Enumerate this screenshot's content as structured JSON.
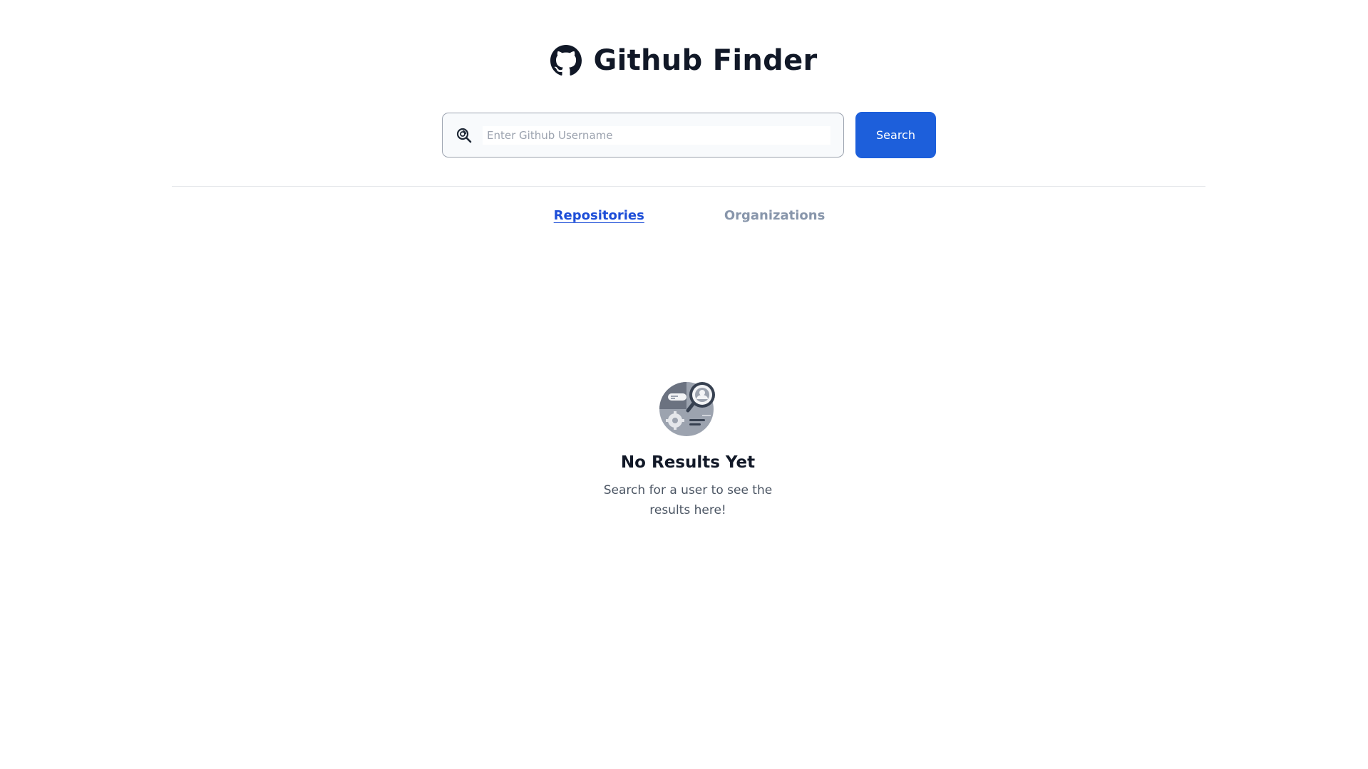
{
  "header": {
    "title": "Github Finder",
    "logo_icon": "github-icon"
  },
  "search": {
    "placeholder": "Enter Github Username",
    "value": "",
    "icon": "search-icon",
    "button_label": "Search",
    "button_color": "#1d5fdb"
  },
  "tabs": [
    {
      "label": "Repositories",
      "active": true
    },
    {
      "label": "Organizations",
      "active": false
    }
  ],
  "empty_state": {
    "illustration": "search-profile-illustration",
    "title": "No Results Yet",
    "message": "Search for a user to see the results here!"
  },
  "colors": {
    "accent": "#1d4ed8",
    "inactive_tab": "#8896ab",
    "text": "#111827"
  }
}
